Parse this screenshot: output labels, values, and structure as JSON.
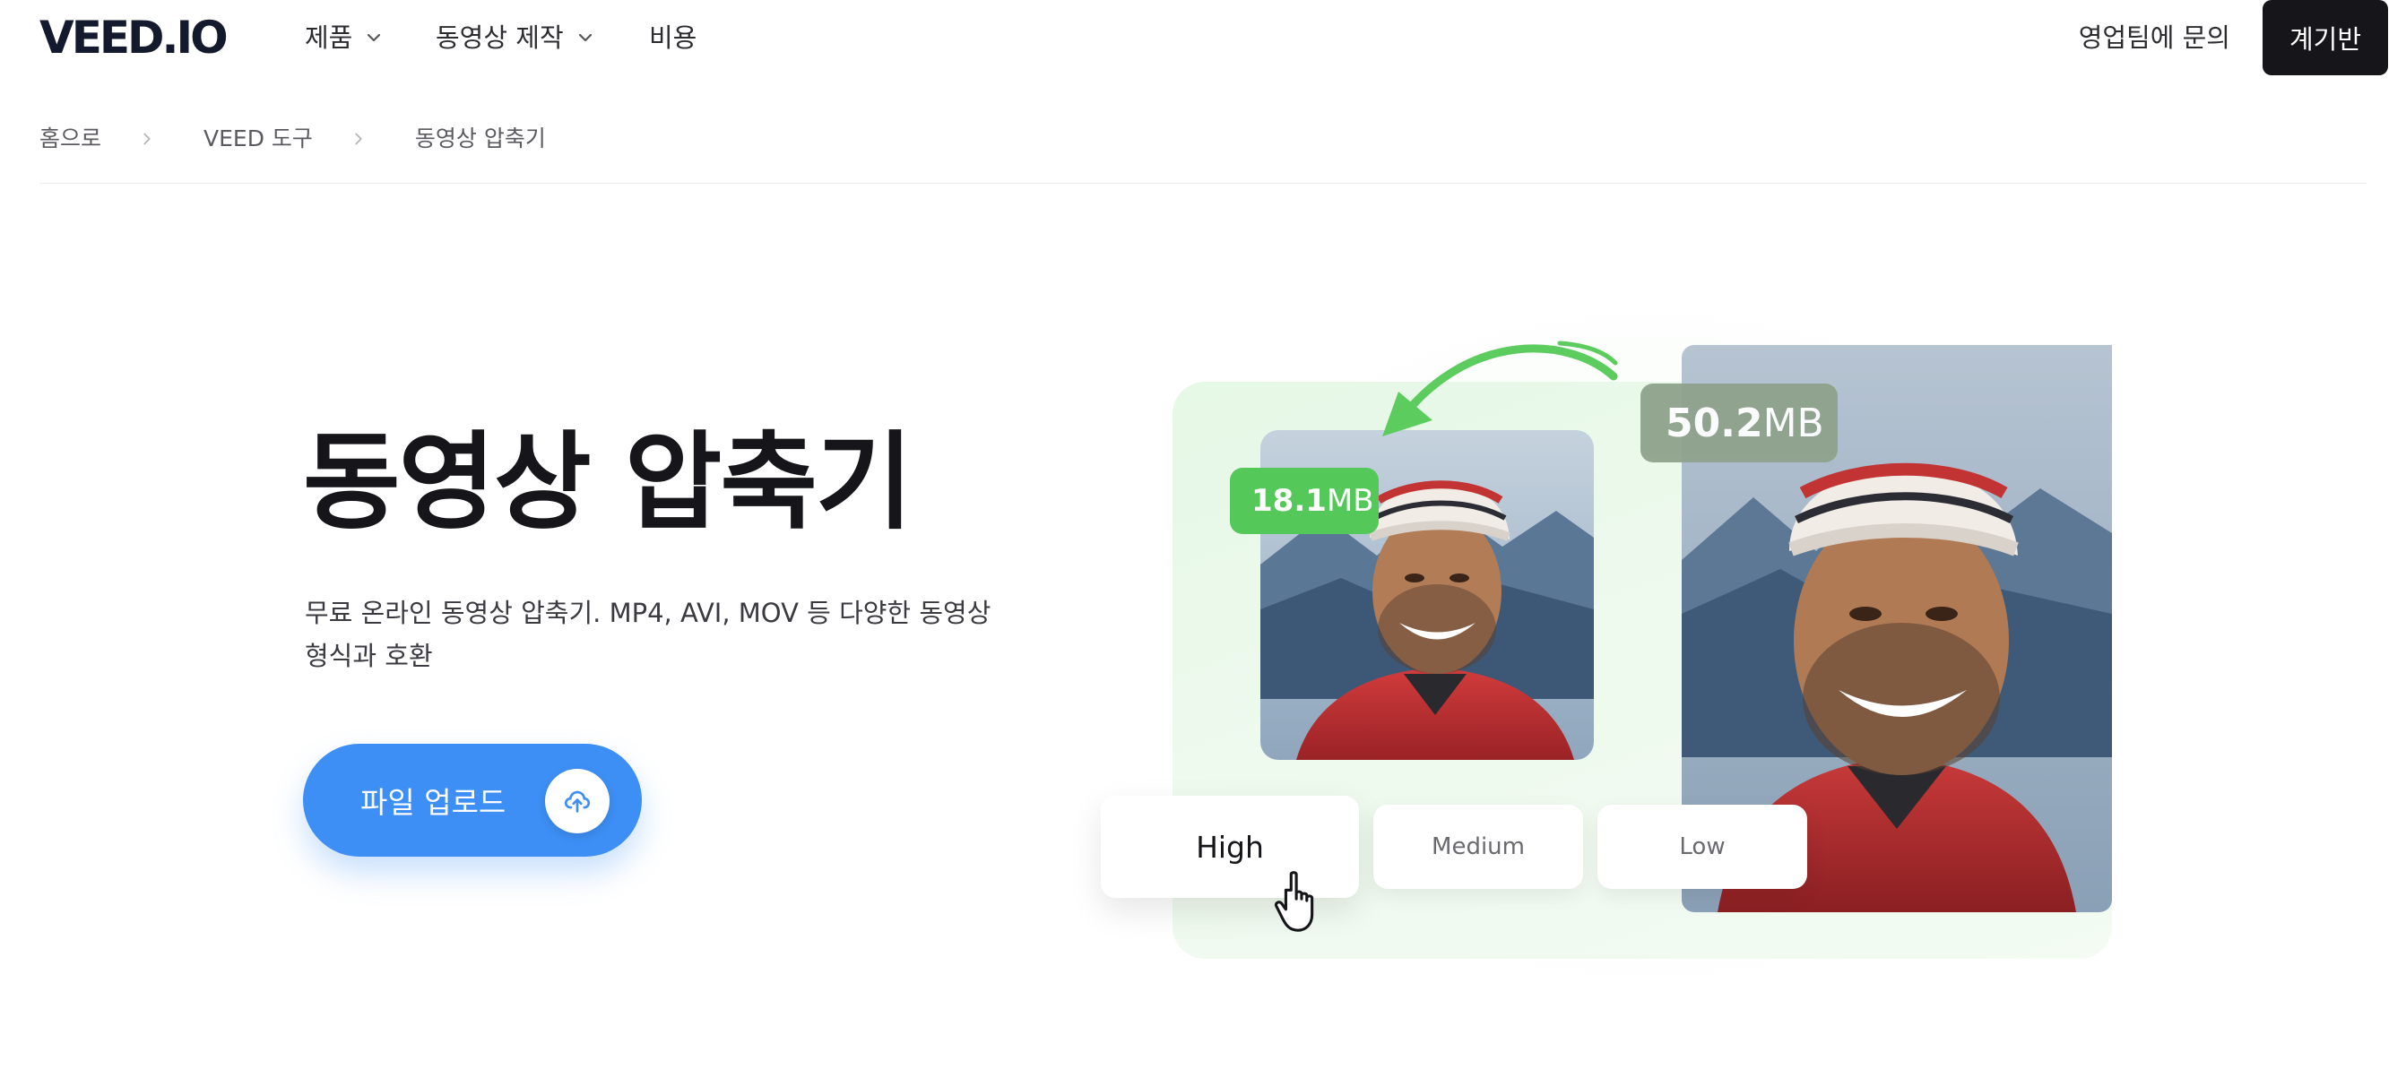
{
  "nav": {
    "logo": "VEED.IO",
    "items": [
      {
        "label": "제품"
      },
      {
        "label": "동영상 제작"
      },
      {
        "label": "비용"
      }
    ],
    "contact_label": "영업팀에 문의",
    "dashboard_label": "계기반"
  },
  "breadcrumb": {
    "items": [
      "홈으로",
      "VEED 도구",
      "동영상 압축기"
    ]
  },
  "hero": {
    "title": "동영상 압축기",
    "subtitle": "무료 온라인 동영상 압축기. MP4, AVI, MOV 등 다양한 동영상 형식과 호환",
    "upload_label": "파일 업로드"
  },
  "illustration": {
    "small_size_value": "18.1",
    "small_size_unit": "MB",
    "large_size_value": "50.2",
    "large_size_unit": "MB",
    "quality_options": [
      "High",
      "Medium",
      "Low"
    ],
    "selected_quality": "High"
  },
  "colors": {
    "accent_blue": "#3d8ff5",
    "badge_green": "#55c85a",
    "badge_gray_green": "#8fa28c",
    "panel_green": "#e6f8e6",
    "dark": "#16161a"
  },
  "icons": [
    "chevron-down-icon",
    "chevron-right-icon",
    "upload-cloud-icon",
    "curved-arrow-icon",
    "hand-pointer-icon"
  ]
}
